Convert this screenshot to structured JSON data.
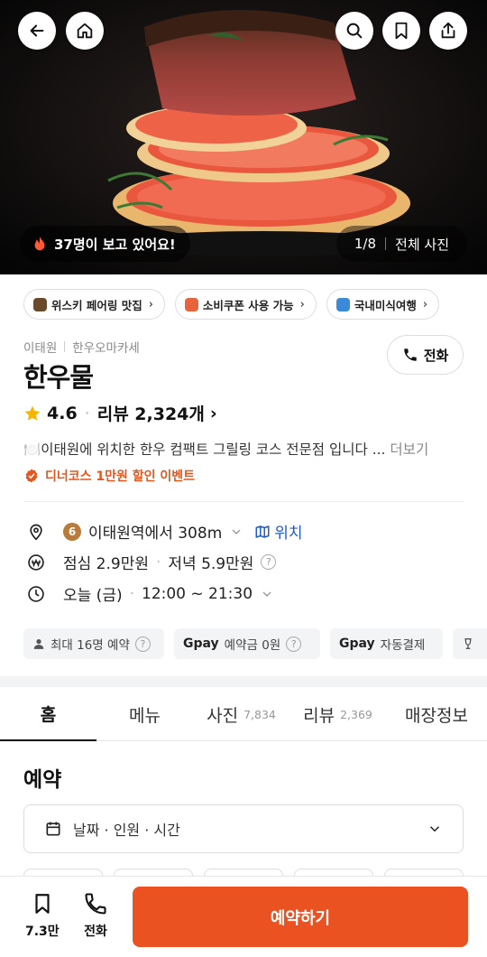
{
  "hero": {
    "viewers_text": "37명이 보고 있어요!",
    "photo_index": "1/8",
    "all_photos": "전체 사진"
  },
  "chips": [
    {
      "label": "위스키 페어링 맛집",
      "icon_color": "#6b4a2b"
    },
    {
      "label": "소비쿠폰 사용 가능",
      "icon_color": "#e8643c"
    },
    {
      "label": "국내미식여행",
      "icon_color": "#3a8ad9"
    }
  ],
  "restaurant": {
    "area": "이태원",
    "category": "한우오마카세",
    "name": "한우물",
    "rating": "4.6",
    "reviews": "리뷰 2,324개",
    "description": "🍽️이태원에 위치한 한우 컴팩트 그릴링 코스 전문점 입니다 ...",
    "more": "더보기",
    "event": "디너코스 1만원 할인 이벤트",
    "call_label": "전화"
  },
  "info": {
    "subway_line": "6",
    "location": "이태원역에서 308m",
    "map_link": "위치",
    "lunch": "점심 2.9만원",
    "dinner": "저녁 5.9만원",
    "hours_day": "오늘 (금)",
    "hours_time": "12:00 ~ 21:30"
  },
  "features": {
    "max_party": "최대 16명 예약",
    "pay_brand": "pay",
    "deposit": "예약금 0원",
    "autopay": "자동결제"
  },
  "tabs": [
    {
      "label": "홈",
      "count": ""
    },
    {
      "label": "메뉴",
      "count": ""
    },
    {
      "label": "사진",
      "count": "7,834"
    },
    {
      "label": "리뷰",
      "count": "2,369"
    },
    {
      "label": "매장정보",
      "count": ""
    }
  ],
  "reservation": {
    "title": "예약",
    "picker": "날짜 · 인원 · 시간"
  },
  "bottom_bar": {
    "save_count": "7.3만",
    "call": "전화",
    "reserve": "예약하기"
  },
  "colors": {
    "accent": "#ea5222",
    "link": "#1f5cc5",
    "event": "#e2581f"
  }
}
